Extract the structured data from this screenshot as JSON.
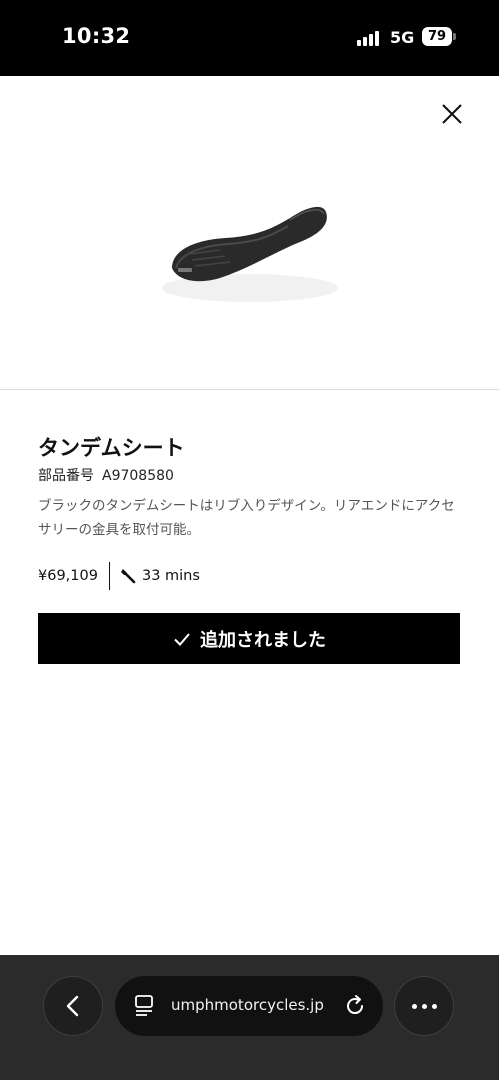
{
  "status_bar": {
    "time": "10:32",
    "network": "5G",
    "battery": "79"
  },
  "modal": {
    "close_icon": "close-icon",
    "product_image_icon": "motorcycle-seat-image",
    "product_name": "タンデムシート",
    "part_number_label": "部品番号",
    "part_number": "A9708580",
    "description": "ブラックのタンデムシートはリブ入りデザイン。リアエンドにアクセサリーの金具を取付可能。",
    "price": "¥69,109",
    "install_time": "33 mins",
    "added_button_label": "追加されました",
    "colors": {
      "button_bg": "#000000",
      "button_text": "#ffffff"
    }
  },
  "browser": {
    "url": "umphmotorcycles.jp",
    "back_icon": "chevron-left-icon",
    "reader_icon": "reader-icon",
    "reload_icon": "reload-icon",
    "more_icon": "more-icon"
  }
}
